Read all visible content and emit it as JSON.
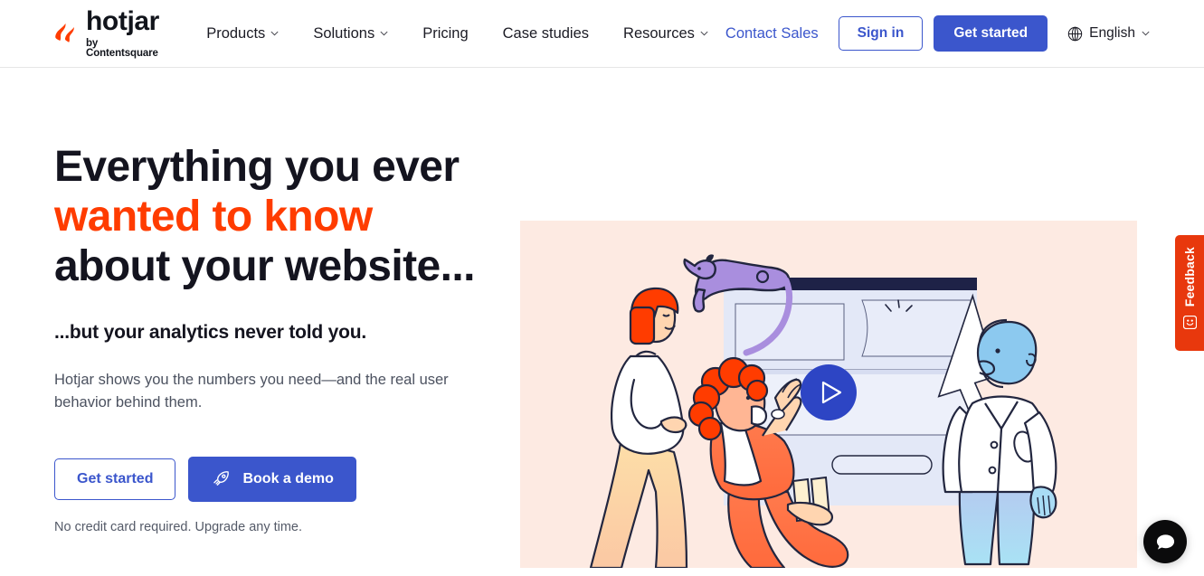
{
  "brand": {
    "logo_word": "hotjar",
    "logo_tagline": "by Contentsquare",
    "logo_icon": "hotjar-flame-logo",
    "accent_orange": "#ff3c00",
    "primary_blue": "#3b56cc",
    "illustration_bg": "#fdeae2",
    "feedback_red": "#e8380d"
  },
  "header": {
    "nav": [
      {
        "label": "Products",
        "has_dropdown": true
      },
      {
        "label": "Solutions",
        "has_dropdown": true
      },
      {
        "label": "Pricing",
        "has_dropdown": false
      },
      {
        "label": "Case studies",
        "has_dropdown": false
      },
      {
        "label": "Resources",
        "has_dropdown": true
      }
    ],
    "contact_sales": "Contact Sales",
    "sign_in": "Sign in",
    "get_started": "Get started",
    "language": "English",
    "language_icon": "globe-icon",
    "caret_icon": "chevron-down-icon"
  },
  "hero": {
    "headline_part1": "Everything you ever",
    "headline_accent": "wanted to know",
    "headline_part2": " about your website...",
    "subheadline": "...but your analytics never told you.",
    "body": "Hotjar shows you the numbers you need—and the real user behavior behind them.",
    "cta_primary": "Get started",
    "cta_secondary": "Book a demo",
    "cta_secondary_icon": "rocket-icon",
    "fineprint": "No credit card required. Upgrade any time.",
    "illustration_alt": "Three people looking at a website dashboard with a purple cat on top of the screen",
    "play_button_icon": "play-triangle-icon"
  },
  "widgets": {
    "feedback_label": "Feedback",
    "feedback_icon": "smiley-face-icon",
    "chat_icon": "chat-bubble-icon"
  }
}
